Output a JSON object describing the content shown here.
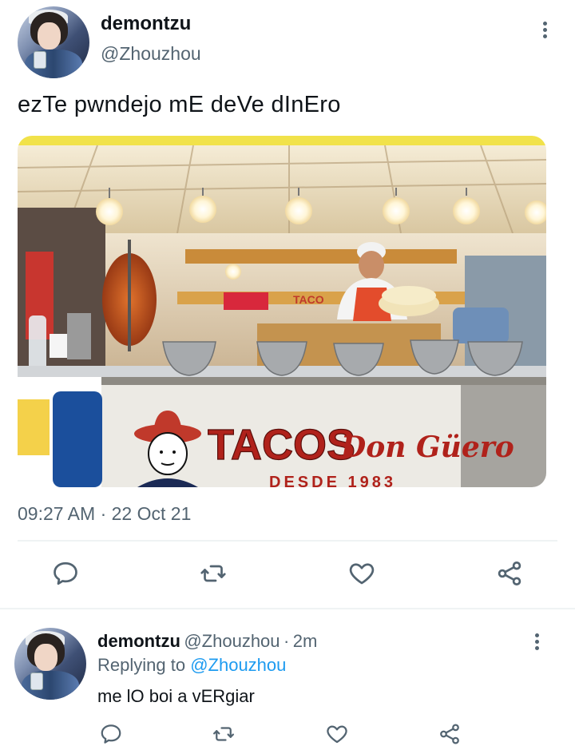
{
  "tweet": {
    "display_name": "demontzu",
    "handle": "@Zhouzhou",
    "text": "ezTe pwndejo mE deVe dInEro",
    "image_sign_text": "TACOS",
    "image_sign_script": "Don Güero",
    "image_sign_sub": "DESDE 1983",
    "image_shelf_label": "TACO",
    "time": "09:27 AM",
    "separator": "·",
    "date": "22 Oct 21"
  },
  "reply": {
    "display_name": "demontzu",
    "handle": "@Zhouzhou",
    "dot": "·",
    "age": "2m",
    "replying_prefix": "Replying to",
    "replying_to": "@Zhouzhou",
    "text": "me lO boi a vERgiar"
  },
  "colors": {
    "accent": "#1d9bf0",
    "secondary_text": "#536471",
    "icon": "#536471",
    "divider": "#eff3f4"
  },
  "icons": {
    "reply": "speech-bubble-icon",
    "retweet": "retweet-icon",
    "like": "heart-icon",
    "share": "share-icon",
    "more": "more-vertical-icon"
  }
}
